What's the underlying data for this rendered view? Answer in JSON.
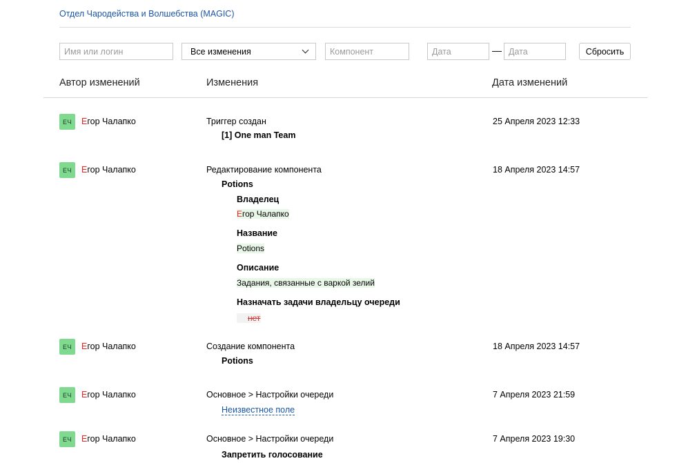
{
  "breadcrumb": "Отдел Чародейства и Волшебства (MAGIC)",
  "filters": {
    "name_placeholder": "Имя или логин",
    "changes_select": "Все изменения",
    "component_placeholder": "Компонент",
    "date_from_placeholder": "Дата",
    "date_separator": "—",
    "date_to_placeholder": "Дата",
    "reset_label": "Сбросить"
  },
  "columns": {
    "author": "Автор изменений",
    "changes": "Изменения",
    "date": "Дата изменений"
  },
  "author": {
    "initials": "ЕЧ",
    "first_letter": "Е",
    "name_rest": "гор Чалапко"
  },
  "rows": [
    {
      "change": "Триггер создан",
      "detail": "[1] One man Team",
      "date": "25 Апреля 2023 12:33"
    },
    {
      "change": "Редактирование компонента",
      "detail": "Potions",
      "date": "18 Апреля 2023 14:57",
      "fields": [
        {
          "label": "Владелец",
          "value_first": "Е",
          "value_rest": "гор Чалапко"
        },
        {
          "label": "Название",
          "value": "Potions"
        },
        {
          "label": "Описание",
          "value": "Задания, связанные с варкой зелий"
        },
        {
          "label": "Назначать задачи владельцу очереди",
          "value": "нет"
        }
      ]
    },
    {
      "change": "Создание компонента",
      "detail": "Potions",
      "date": "18 Апреля 2023 14:57"
    },
    {
      "change": "Основное > Настройки очереди",
      "link": "Неизвестное поле",
      "date": "7 Апреля 2023 21:59"
    },
    {
      "change": "Основное > Настройки очереди",
      "detail": "Запретить голосование",
      "date": "7 Апреля 2023 19:30"
    }
  ]
}
